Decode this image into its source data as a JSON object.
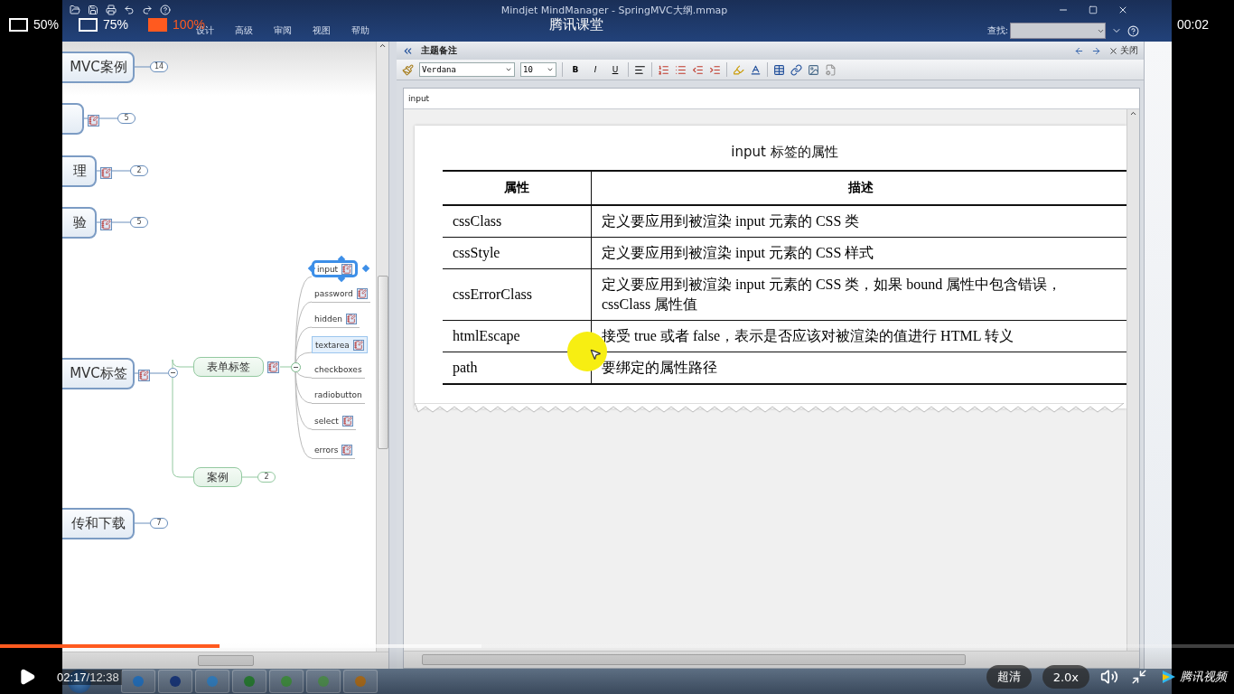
{
  "player": {
    "zoom_options": [
      {
        "label": "50%",
        "selected": false
      },
      {
        "label": "75%",
        "selected": false
      },
      {
        "label": "100%",
        "selected": true
      }
    ],
    "title": "腾讯课堂",
    "clock": "00:02",
    "progress": {
      "level": 0.178
    },
    "buffer": {
      "level": 0.39
    },
    "elapsed": "02:17",
    "duration": "/12:38",
    "quality": "超清",
    "speed": "2.0x",
    "brand": "腾讯视频"
  },
  "window": {
    "title": "Mindjet MindManager - SpringMVC大纲.mmap"
  },
  "ribbon_tabs": [
    "设计",
    "高级",
    "审阅",
    "视图",
    "帮助"
  ],
  "search": {
    "label": "查找:"
  },
  "mind_map": {
    "topics": [
      {
        "label": "MVC案例",
        "count": "14",
        "has_note": false
      },
      {
        "count": "5",
        "has_note": true
      },
      {
        "label": "理",
        "count": "2",
        "has_note": true
      },
      {
        "label": "验",
        "count": "5",
        "has_note": true
      },
      {
        "label": "MVC标签",
        "has_note": true,
        "expanded": true,
        "children": [
          {
            "label": "表单标签",
            "has_note": true,
            "expanded": true,
            "children": [
              {
                "label": "input",
                "has_note": true,
                "selected": true,
                "hovered": false
              },
              {
                "label": "password",
                "has_note": true,
                "selected": false,
                "hovered": false
              },
              {
                "label": "hidden",
                "has_note": true,
                "selected": false,
                "hovered": false
              },
              {
                "label": "textarea",
                "has_note": true,
                "selected": false,
                "hovered": true
              },
              {
                "label": "checkboxes",
                "has_note": false,
                "selected": false,
                "hovered": false
              },
              {
                "label": "radiobutton",
                "has_note": false,
                "selected": false,
                "hovered": false
              },
              {
                "label": "select",
                "has_note": true,
                "selected": false,
                "hovered": false
              },
              {
                "label": "errors",
                "has_note": true,
                "selected": false,
                "hovered": false
              }
            ]
          },
          {
            "label": "案例",
            "count": "2",
            "has_note": false
          }
        ]
      },
      {
        "label": "传和下载",
        "count": "7",
        "has_note": false
      }
    ]
  },
  "notes_panel": {
    "title": "主题备注",
    "close": "关闭",
    "font": "Verdana",
    "size": "10",
    "format_buttons": [
      "B",
      "I",
      "U"
    ],
    "topic_path": "input",
    "document": {
      "title": "input 标签的属性",
      "columns": [
        "属性",
        "描述"
      ],
      "rows": [
        [
          "cssClass",
          "定义要应用到被渲染 input 元素的 CSS 类"
        ],
        [
          "cssStyle",
          "定义要应用到被渲染 input 元素的 CSS 样式"
        ],
        [
          "cssErrorClass",
          "定义要应用到被渲染 input 元素的 CSS 类，如果 bound 属性中包含错误，\ncssClass 属性值"
        ],
        [
          "htmlEscape",
          "接受 true 或者 false，表示是否应该对被渲染的值进行 HTML 转义"
        ],
        [
          "path",
          "要绑定的属性路径"
        ]
      ]
    }
  }
}
